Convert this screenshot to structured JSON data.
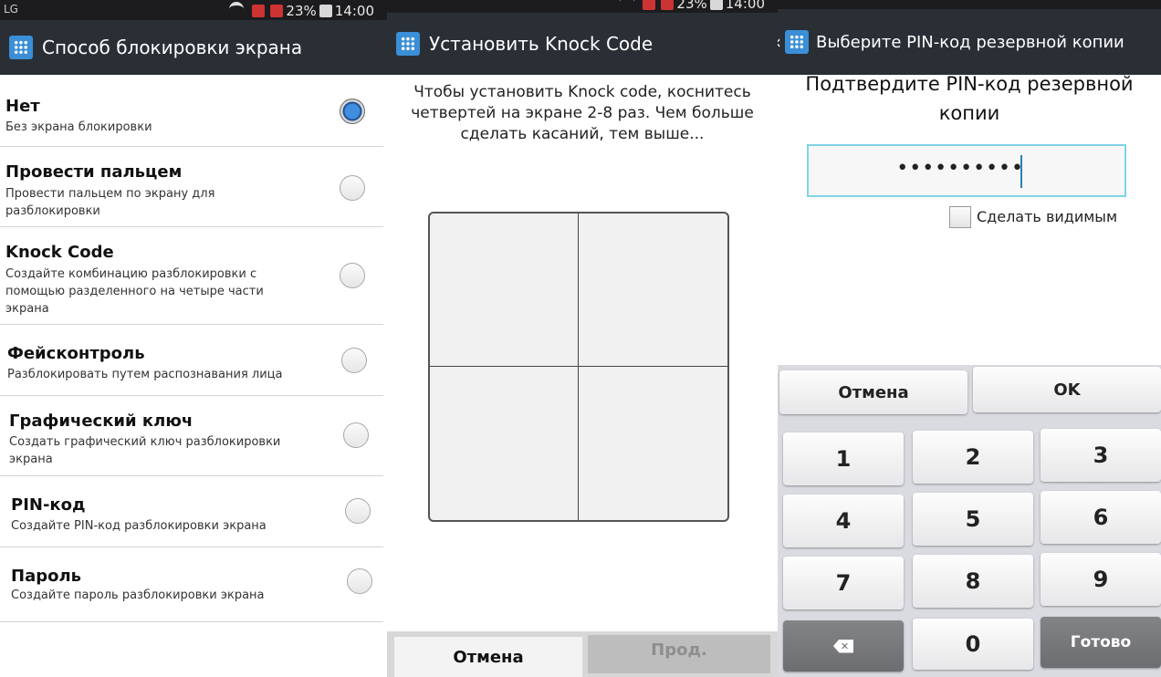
{
  "statusbar": {
    "panel1": {
      "left": "LG",
      "battery": "23%",
      "time": "14:00"
    },
    "panel2": {
      "battery": "23%",
      "time": "14:00"
    }
  },
  "screen1": {
    "title": "Способ блокировки экрана",
    "options": [
      {
        "title": "Нет",
        "subtitle": "Без экрана блокировки",
        "selected": true
      },
      {
        "title": "Провести пальцем",
        "subtitle": "Провести пальцем по экрану для разблокировки",
        "selected": false
      },
      {
        "title": "Knock Code",
        "subtitle": "Создайте комбинацию разблокировки с помощью разделенного на четыре части экрана",
        "selected": false
      },
      {
        "title": "Фейсконтроль",
        "subtitle": "Разблокировать путем распознавания лица",
        "selected": false
      },
      {
        "title": "Графический ключ",
        "subtitle": "Создать графический ключ разблокировки экрана",
        "selected": false
      },
      {
        "title": "PIN-код",
        "subtitle": "Создайте PIN-код разблокировки экрана",
        "selected": false
      },
      {
        "title": "Пароль",
        "subtitle": "Создайте пароль разблокировки экрана",
        "selected": false
      }
    ]
  },
  "screen2": {
    "title": "Установить Knock Code",
    "instruction": "Чтобы установить Knock code, коснитесь четвертей на экране 2-8 раз. Чем больше сделать касаний, тем выше...",
    "cancel_label": "Отмена",
    "next_label": "Прод."
  },
  "screen3": {
    "title": "Выберите PIN-код резервной копии",
    "heading": "Подтвердите PIN-код резервной копии",
    "pin_value": "••••••••••",
    "show_checkbox_label": "Сделать видимым",
    "keyboard": {
      "cancel_label": "Отмена",
      "ok_label": "OK",
      "keys": [
        "1",
        "2",
        "3",
        "4",
        "5",
        "6",
        "7",
        "8",
        "9"
      ],
      "zero": "0",
      "done_label": "Готово"
    }
  },
  "colors": {
    "actionbar": "#2a2f36",
    "radio_selected": "#3f8ee0",
    "pin_border": "#7fd3e6"
  }
}
